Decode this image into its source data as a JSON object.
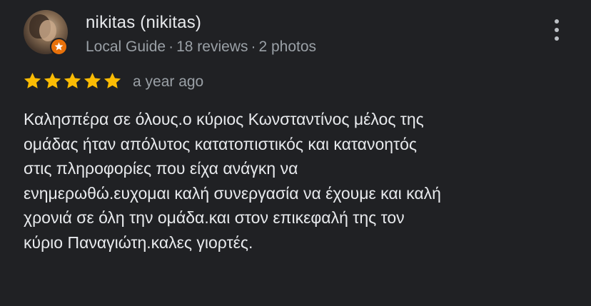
{
  "review": {
    "author": "nikitas (nikitas)",
    "guide_label": "Local Guide",
    "reviews_count": "18 reviews",
    "photos_count": "2 photos",
    "separator": "·",
    "rating": 5,
    "rating_max": 5,
    "time_ago": "a year ago",
    "text": "Καλησπέρα σε όλους.ο κύριος Κωνσταντίνος μέλος της\nομάδας ήταν απόλυτος κατατοπιστικός και κατανοητός\nστις πληροφορίες που είχα ανάγκη να\nενημερωθώ.ευχομαι καλή συνεργασία να έχουμε και καλή\nχρονιά σε όλη την ομάδα.και στον επικεφαλή της τον\nκύριο Παναγιώτη.καλες γιορτές."
  },
  "icons": {
    "avatar": "user-photo",
    "badge": "local-guide-badge-icon",
    "menu": "more-vert-icon",
    "star": "star-icon"
  },
  "colors": {
    "background": "#202124",
    "text_primary": "#e8eaed",
    "text_secondary": "#9aa0a6",
    "star": "#fbbc04",
    "badge": "#e8710a"
  }
}
